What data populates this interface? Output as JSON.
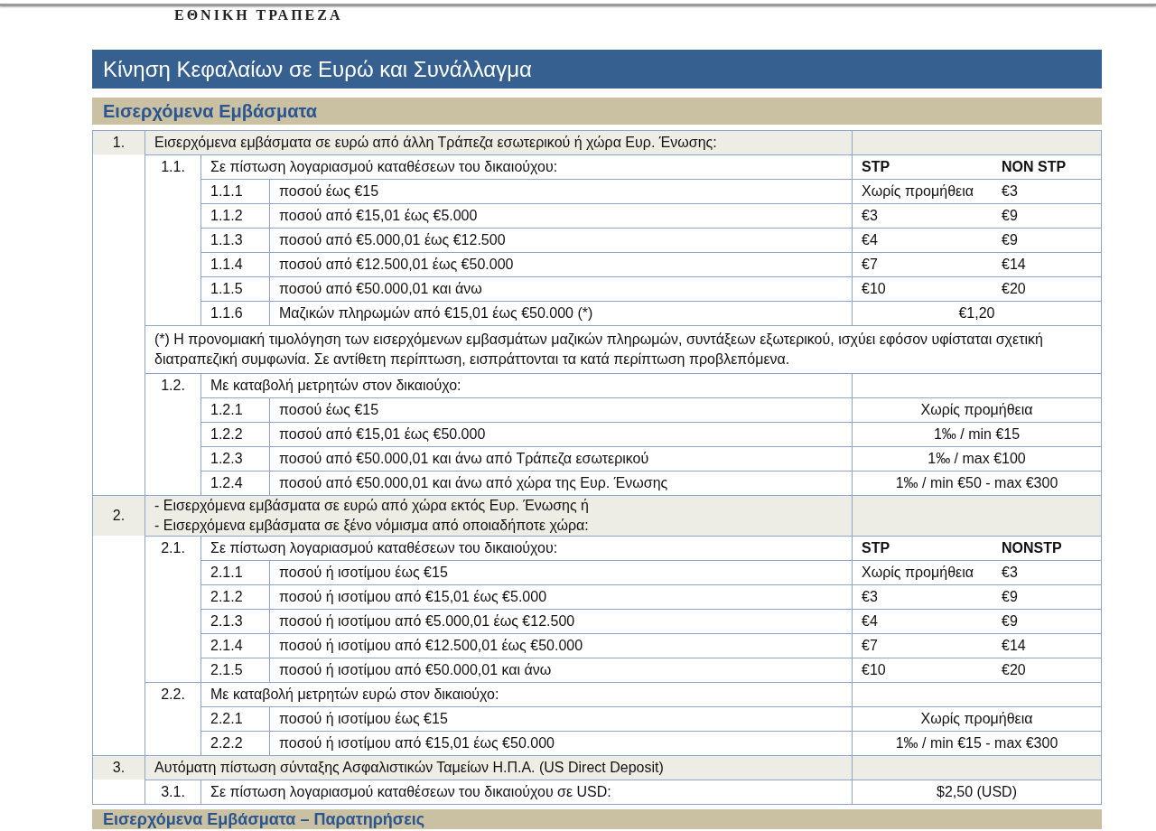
{
  "bank_name": "ΕΘΝΙΚΗ ΤΡΑΠΕΖΑ",
  "title": "Κίνηση Κεφαλαίων σε Ευρώ και Συνάλλαγμα",
  "section": "Εισερχόμενα Εμβάσματα",
  "rows": [
    {
      "kind": "group",
      "number": "1.",
      "lines": [
        "Εισερχόμενα εμβάσματα σε ευρώ από άλλη Τράπεζα εσωτερικού ή χώρα Ευρ. Ένωσης:"
      ]
    },
    {
      "kind": "sub",
      "number": "1.1.",
      "text": "Σε πίστωση λογαριασμού καταθέσεων του δικαιούχου:",
      "stp": "STP",
      "nonstp": "NON STP",
      "header": true
    },
    {
      "kind": "item",
      "number": "1.1.1",
      "text": "ποσού  έως   €15",
      "stp": "Χωρίς προμήθεια",
      "nonstp": "€3"
    },
    {
      "kind": "item",
      "number": "1.1.2",
      "text": "ποσού  από  €15,01  έως  €5.000",
      "stp": "€3",
      "nonstp": "€9"
    },
    {
      "kind": "item",
      "number": "1.1.3",
      "text": "ποσού  από  €5.000,01  έως  €12.500",
      "stp": "€4",
      "nonstp": "€9"
    },
    {
      "kind": "item",
      "number": "1.1.4",
      "text": "ποσού  από  €12.500,01  έως  €50.000",
      "stp": "€7",
      "nonstp": "€14"
    },
    {
      "kind": "item",
      "number": "1.1.5",
      "text": "ποσού  από  €50.000,01 και άνω",
      "stp": "€10",
      "nonstp": "€20"
    },
    {
      "kind": "item",
      "number": "1.1.6",
      "text": "Μαζικών πληρωμών από €15,01  έως  €50.000  (*)",
      "value": "€1,20"
    },
    {
      "kind": "note",
      "text": "(*) Η προνομιακή τιμολόγηση των εισερχόμενων εμβασμάτων μαζικών πληρωμών, συντάξεων  εξωτερικού, ισχύει εφόσον υφίσταται σχετική διατραπεζική συμφωνία. Σε αντίθετη περίπτωση, εισπράττονται τα κατά περίπτωση προβλεπόμενα."
    },
    {
      "kind": "sub",
      "number": "1.2.",
      "text": "Με καταβολή μετρητών στον δικαιούχο:"
    },
    {
      "kind": "item",
      "number": "1.2.1",
      "text": "ποσού  έως   €15",
      "value": "Χωρίς προμήθεια"
    },
    {
      "kind": "item",
      "number": "1.2.2",
      "text": "ποσού  από  €15,01  έως  €50.000",
      "value": "1‰ / min €15"
    },
    {
      "kind": "item",
      "number": "1.2.3",
      "text": "ποσού  από  €50.000,01  και  άνω από  Τράπεζα  εσωτερικού",
      "value": "1‰ / max €100"
    },
    {
      "kind": "item",
      "number": "1.2.4",
      "text": "ποσού  από  €50.000,01  και  άνω από  χώρα  της  Ευρ.  Ένωσης",
      "value": "1‰ / min €50 - max €300"
    },
    {
      "kind": "group",
      "number": "2.",
      "lines": [
        "- Εισερχόμενα εμβάσματα σε ευρώ από χώρα εκτός Ευρ. Ένωσης  ή",
        "- Εισερχόμενα εμβάσματα σε ξένο νόμισμα από οποιαδήποτε χώρα:"
      ]
    },
    {
      "kind": "sub",
      "number": "2.1.",
      "text": "Σε πίστωση λογαριασμού καταθέσεων του δικαιούχου:",
      "stp": "STP",
      "nonstp": "NONSTP",
      "header": true
    },
    {
      "kind": "item",
      "number": "2.1.1",
      "text": "ποσού ή ισοτίμου    έως   €15",
      "stp": "Χωρίς προμήθεια",
      "nonstp": "€3"
    },
    {
      "kind": "item",
      "number": "2.1.2",
      "text": "ποσού ή ισοτίμου   από  €15,01  έως  €5.000",
      "stp": "€3",
      "nonstp": "€9"
    },
    {
      "kind": "item",
      "number": "2.1.3",
      "text": "ποσού ή ισοτίμου   από  €5.000,01 έως €12.500",
      "stp": "€4",
      "nonstp": "€9"
    },
    {
      "kind": "item",
      "number": "2.1.4",
      "text": "ποσού ή ισοτίμου   από  €12.500,01  έως €50.000",
      "stp": "€7",
      "nonstp": "€14"
    },
    {
      "kind": "item",
      "number": "2.1.5",
      "text": "ποσού ή ισοτίμου   από  €50.000,01   και  άνω",
      "stp": "€10",
      "nonstp": "€20"
    },
    {
      "kind": "sub",
      "number": "2.2.",
      "text": "Με καταβολή μετρητών ευρώ στον δικαιούχο:"
    },
    {
      "kind": "item",
      "number": "2.2.1",
      "text": "ποσού ή ισοτίμου  έως   €15",
      "value": "Χωρίς προμήθεια"
    },
    {
      "kind": "item",
      "number": "2.2.2",
      "text": "ποσού ή ισοτίμου  από  €15,01  έως   €50.000",
      "value": "1‰ / min €15 - max €300"
    },
    {
      "kind": "group",
      "number": "3.",
      "lines": [
        "Αυτόματη πίστωση σύνταξης Ασφαλιστικών Ταμείων Η.Π.Α. (US Direct Deposit)"
      ]
    },
    {
      "kind": "sub",
      "number": "3.1.",
      "text": "Σε πίστωση λογαριασμού καταθέσεων του δικαιούχου σε USD:",
      "value": "$2,50 (USD)"
    }
  ],
  "next_section": "Εισερχόμενα Εμβάσματα  – Παρατηρήσεις"
}
